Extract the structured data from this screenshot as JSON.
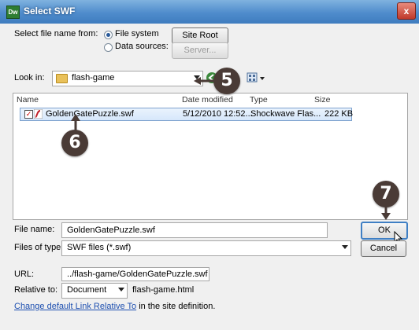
{
  "window": {
    "title": "Select SWF",
    "app_icon": "Dw",
    "close_label": "x"
  },
  "source": {
    "label": "Select file name from:",
    "option_file_system": "File system",
    "option_data_sources": "Data sources:",
    "selected": "File system",
    "site_root_label": "Site Root",
    "server_label": "Server..."
  },
  "lookin": {
    "label": "Look in:",
    "value": "flash-game"
  },
  "columns": {
    "name": "Name",
    "date": "Date modified",
    "type": "Type",
    "size": "Size"
  },
  "files": [
    {
      "name": "GoldenGatePuzzle.swf",
      "date": "5/12/2010 12:52...",
      "type": "Shockwave Flas...",
      "size": "222 KB",
      "checked": true
    }
  ],
  "filename": {
    "label": "File name:",
    "value": "GoldenGatePuzzle.swf"
  },
  "filetype": {
    "label": "Files of type:",
    "value": "SWF files (*.swf)"
  },
  "buttons": {
    "ok": "OK",
    "cancel": "Cancel"
  },
  "url": {
    "label": "URL:",
    "value": "../flash-game/GoldenGatePuzzle.swf"
  },
  "relative": {
    "label": "Relative to:",
    "value": "Document",
    "file": "flash-game.html"
  },
  "footer": {
    "link": "Change default Link Relative To",
    "suffix": "in the site definition."
  },
  "callouts": {
    "five": "5",
    "six": "6",
    "seven": "7"
  },
  "colors": {
    "callout_bg": "#4a3b36",
    "title_gradient": "#4f8ccc",
    "selection": "#d6e7fb"
  }
}
